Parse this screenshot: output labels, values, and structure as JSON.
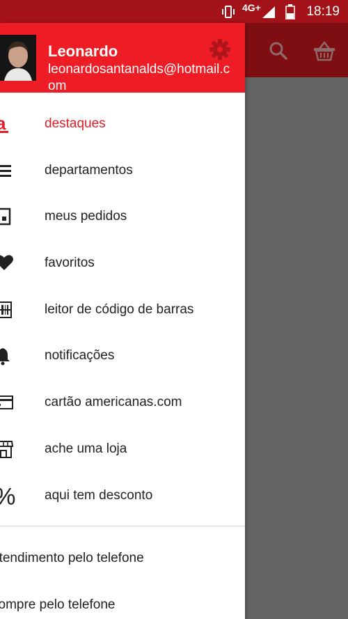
{
  "status_bar": {
    "network": "4G+",
    "time": "18:19"
  },
  "header": {
    "name": "Leonardo",
    "email": "leonardosantanalds@hotmail.com"
  },
  "menu": [
    {
      "label": "destaques",
      "icon": "brand-a-icon"
    },
    {
      "label": "departamentos",
      "icon": "list-icon"
    },
    {
      "label": "meus pedidos",
      "icon": "order-box-icon"
    },
    {
      "label": "favoritos",
      "icon": "heart-icon"
    },
    {
      "label": "leitor de código de barras",
      "icon": "barcode-icon"
    },
    {
      "label": "notificações",
      "icon": "bell-icon"
    },
    {
      "label": "cartão americanas.com",
      "icon": "card-icon"
    },
    {
      "label": "ache uma loja",
      "icon": "store-icon"
    },
    {
      "label": "aqui tem desconto",
      "icon": "percent-icon"
    }
  ],
  "footer": [
    {
      "label": "atendimento pelo telefone"
    },
    {
      "label": "compre pelo telefone"
    }
  ],
  "colors": {
    "accent": "#ee1c25",
    "status_bar": "#a31218",
    "toolbar": "#7e0e12",
    "scrim": "#646464"
  }
}
